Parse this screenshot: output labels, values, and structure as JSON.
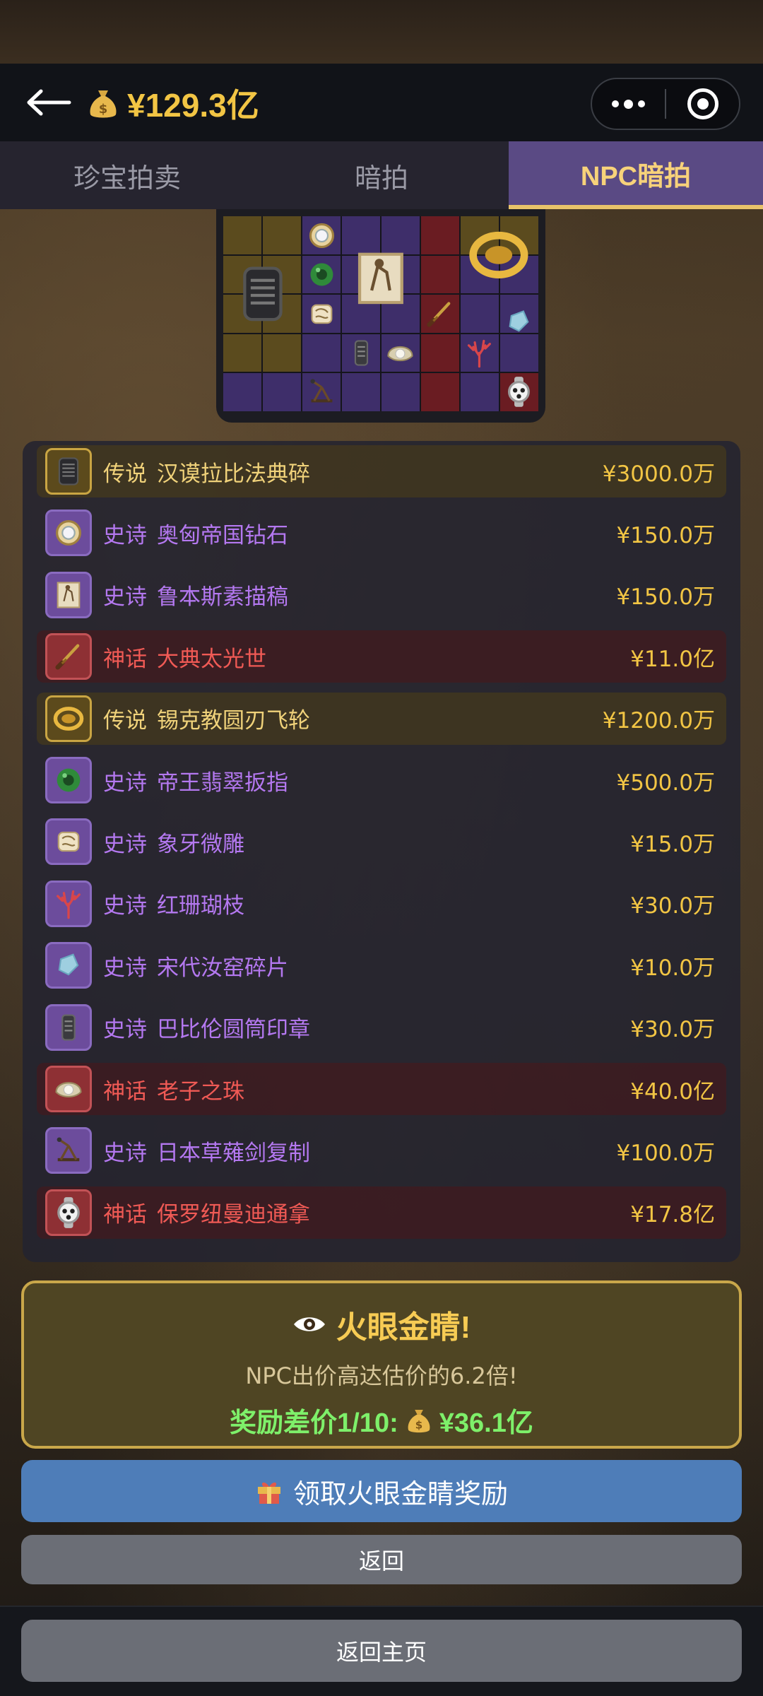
{
  "header": {
    "balance": "¥129.3亿",
    "back_icon": "back-arrow-icon",
    "money_icon": "money-bag-icon"
  },
  "tabs": [
    {
      "label": "珍宝拍卖",
      "active": false
    },
    {
      "label": "暗拍",
      "active": false
    },
    {
      "label": "NPC暗拍",
      "active": true
    }
  ],
  "items": [
    {
      "tier": "传说",
      "name": "汉谟拉比法典碎",
      "price": "¥3000.0万",
      "rarity": "legend",
      "icon": "stone-tablet-icon"
    },
    {
      "tier": "史诗",
      "name": "奥匈帝国钻石",
      "price": "¥150.0万",
      "rarity": "epic",
      "icon": "diamond-brooch-icon"
    },
    {
      "tier": "史诗",
      "name": "鲁本斯素描稿",
      "price": "¥150.0万",
      "rarity": "epic",
      "icon": "sketch-icon"
    },
    {
      "tier": "神话",
      "name": "大典太光世",
      "price": "¥11.0亿",
      "rarity": "myth",
      "icon": "katana-icon"
    },
    {
      "tier": "传说",
      "name": "锡克教圆刃飞轮",
      "price": "¥1200.0万",
      "rarity": "legend",
      "icon": "chakram-icon"
    },
    {
      "tier": "史诗",
      "name": "帝王翡翠扳指",
      "price": "¥500.0万",
      "rarity": "epic",
      "icon": "jade-ring-icon"
    },
    {
      "tier": "史诗",
      "name": "象牙微雕",
      "price": "¥15.0万",
      "rarity": "epic",
      "icon": "ivory-carving-icon"
    },
    {
      "tier": "史诗",
      "name": "红珊瑚枝",
      "price": "¥30.0万",
      "rarity": "epic",
      "icon": "coral-icon"
    },
    {
      "tier": "史诗",
      "name": "宋代汝窑碎片",
      "price": "¥10.0万",
      "rarity": "epic",
      "icon": "porcelain-shard-icon"
    },
    {
      "tier": "史诗",
      "name": "巴比伦圆筒印章",
      "price": "¥30.0万",
      "rarity": "epic",
      "icon": "cylinder-seal-icon"
    },
    {
      "tier": "神话",
      "name": "老子之珠",
      "price": "¥40.0亿",
      "rarity": "myth",
      "icon": "pearl-shell-icon"
    },
    {
      "tier": "史诗",
      "name": "日本草薙剑复制",
      "price": "¥100.0万",
      "rarity": "epic",
      "icon": "catapult-icon"
    },
    {
      "tier": "神话",
      "name": "保罗纽曼迪通拿",
      "price": "¥17.8亿",
      "rarity": "myth",
      "icon": "watch-icon"
    }
  ],
  "reward": {
    "title": "火眼金睛!",
    "title_icon": "eye-icon",
    "description": "NPC出价高达估价的6.2倍!",
    "amount_label": "奖励差价1/10:",
    "amount_icon": "money-bag-icon",
    "amount": "¥36.1亿"
  },
  "buttons": {
    "claim": "领取火眼金睛奖励",
    "claim_icon": "gift-icon",
    "back": "返回",
    "home": "返回主页"
  },
  "colors": {
    "gold": "#f2c544",
    "epic": "#b478f0",
    "myth": "#f05a55",
    "legend": "#f0d27a",
    "tab_active": "#5a4a84",
    "claim_button": "#4e7db8",
    "green_reward": "#7ef06a"
  }
}
